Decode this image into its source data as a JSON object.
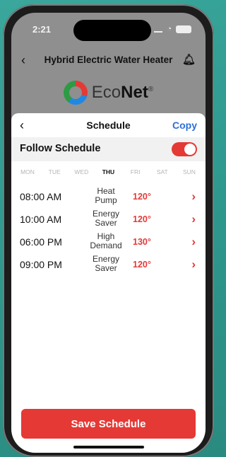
{
  "status": {
    "time": "2:21"
  },
  "topnav": {
    "title": "Hybrid Electric Water Heater"
  },
  "logo": {
    "eco": "Eco",
    "net": "Net",
    "reg": "®"
  },
  "sheet": {
    "title": "Schedule",
    "copy_label": "Copy",
    "follow_label": "Follow Schedule",
    "follow_enabled": true
  },
  "days": [
    {
      "label": "MON",
      "active": false
    },
    {
      "label": "TUE",
      "active": false
    },
    {
      "label": "WED",
      "active": false
    },
    {
      "label": "THU",
      "active": true
    },
    {
      "label": "FRI",
      "active": false
    },
    {
      "label": "SAT",
      "active": false
    },
    {
      "label": "SUN",
      "active": false
    }
  ],
  "schedule": [
    {
      "time": "08:00 AM",
      "mode": "Heat Pump",
      "temp": "120°"
    },
    {
      "time": "10:00 AM",
      "mode": "Energy Saver",
      "temp": "120°"
    },
    {
      "time": "06:00 PM",
      "mode": "High Demand",
      "temp": "130°"
    },
    {
      "time": "09:00 PM",
      "mode": "Energy Saver",
      "temp": "120°"
    }
  ],
  "save_label": "Save Schedule",
  "colors": {
    "accent": "#e53935",
    "link": "#2f6fd8"
  },
  "icons": {
    "back": "chevron-left-icon",
    "bell": "bell-icon",
    "row_chevron": "chevron-right-icon"
  }
}
